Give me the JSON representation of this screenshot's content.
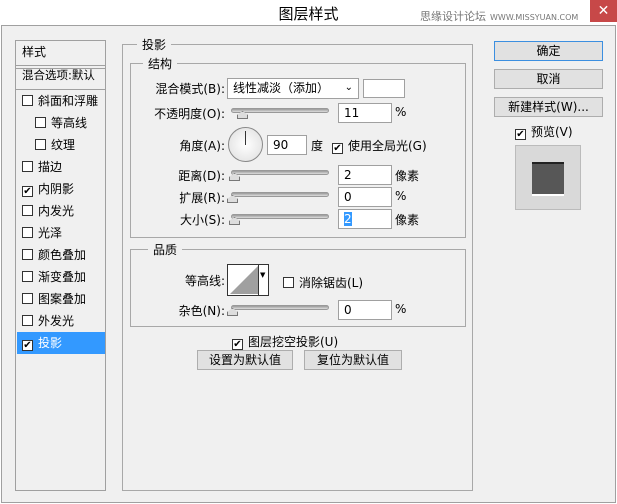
{
  "window": {
    "title": "图层样式",
    "close": "✕",
    "watermark_cn": "思缘设计论坛",
    "watermark_url": "WWW.MISSYUAN.COM"
  },
  "sidebar": {
    "header": "样式",
    "blend_options": "混合选项:默认",
    "items": [
      {
        "label": "斜面和浮雕",
        "checked": false
      },
      {
        "label": "等高线",
        "checked": false
      },
      {
        "label": "纹理",
        "checked": false
      },
      {
        "label": "描边",
        "checked": false
      },
      {
        "label": "内阴影",
        "checked": true
      },
      {
        "label": "内发光",
        "checked": false
      },
      {
        "label": "光泽",
        "checked": false
      },
      {
        "label": "颜色叠加",
        "checked": false
      },
      {
        "label": "渐变叠加",
        "checked": false
      },
      {
        "label": "图案叠加",
        "checked": false
      },
      {
        "label": "外发光",
        "checked": false
      },
      {
        "label": "投影",
        "checked": true
      }
    ]
  },
  "panel": {
    "title": "投影",
    "structure": {
      "title": "结构",
      "blend_mode_label": "混合模式(B):",
      "blend_mode": "线性减淡（添加）",
      "shadow_color": "#ffffff",
      "opacity_label": "不透明度(O):",
      "opacity": "11",
      "opacity_unit": "%",
      "angle_label": "角度(A):",
      "angle": "90",
      "angle_unit": "度",
      "global_light_label": "使用全局光(G)",
      "global_light": true,
      "distance_label": "距离(D):",
      "distance": "2",
      "distance_unit": "像素",
      "spread_label": "扩展(R):",
      "spread": "0",
      "spread_unit": "%",
      "size_label": "大小(S):",
      "size": "2",
      "size_unit": "像素"
    },
    "quality": {
      "title": "品质",
      "contour_label": "等高线:",
      "antialias_label": "消除锯齿(L)",
      "antialias": false,
      "noise_label": "杂色(N):",
      "noise": "0",
      "noise_unit": "%"
    },
    "knockout_label": "图层挖空投影(U)",
    "knockout": true,
    "set_default": "设置为默认值",
    "reset_default": "复位为默认值"
  },
  "actions": {
    "ok": "确定",
    "cancel": "取消",
    "new_style": "新建样式(W)...",
    "preview_label": "预览(V)",
    "preview": true
  },
  "colors": {
    "selection": "#3399ff",
    "close": "#c74848"
  }
}
